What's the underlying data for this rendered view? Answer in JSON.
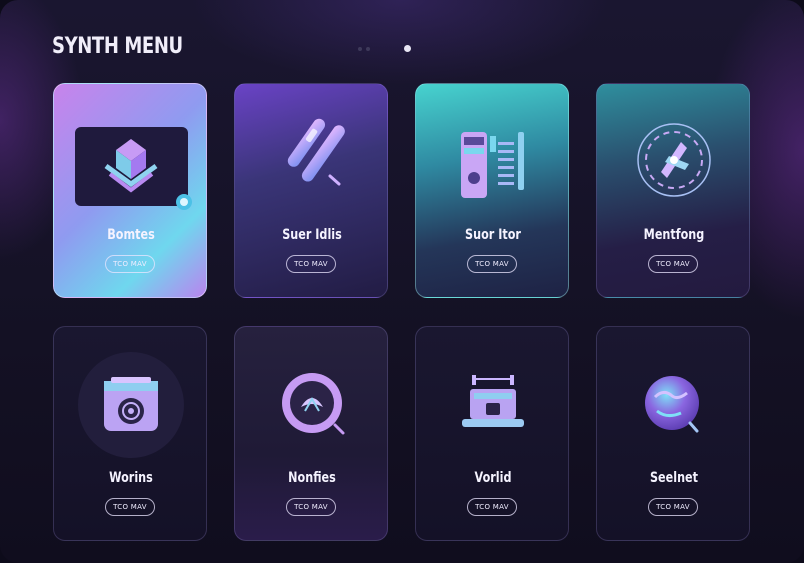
{
  "header": {
    "title": "SYNTH MENU"
  },
  "pager": {
    "pages": 3,
    "active": 3
  },
  "cards": [
    {
      "label": "Bomtes",
      "button": "TCO MAV",
      "icon": "cube-display-icon"
    },
    {
      "label": "Suer Idlis",
      "button": "TCO MAV",
      "icon": "slider-bars-icon"
    },
    {
      "label": "Suor Itor",
      "button": "TCO MAV",
      "icon": "equalizer-device-icon"
    },
    {
      "label": "Mentfong",
      "button": "TCO MAV",
      "icon": "dial-knob-icon"
    },
    {
      "label": "Worins",
      "button": "TCO MAV",
      "icon": "film-camera-icon"
    },
    {
      "label": "Nonfies",
      "button": "TCO MAV",
      "icon": "badge-emblem-icon"
    },
    {
      "label": "Vorlid",
      "button": "TCO MAV",
      "icon": "console-device-icon"
    },
    {
      "label": "Seelnet",
      "button": "TCO MAV",
      "icon": "globe-orb-icon"
    }
  ]
}
